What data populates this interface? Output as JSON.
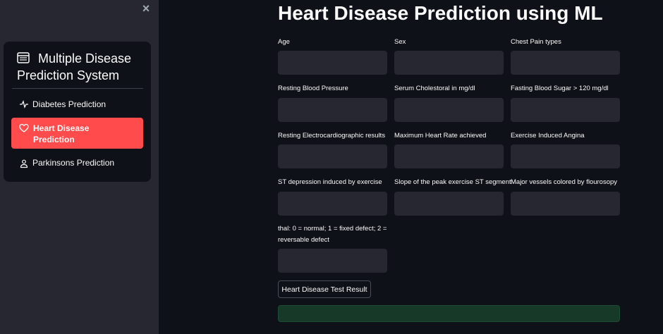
{
  "sidebar": {
    "close_label": "×",
    "menu_title": "Multiple Disease Prediction System",
    "header_icon": "list-window-icon",
    "items": [
      {
        "label": "Diabetes Prediction",
        "icon": "activity-icon",
        "active": false
      },
      {
        "label": "Heart Disease Prediction",
        "icon": "heart-icon",
        "active": true
      },
      {
        "label": "Parkinsons Prediction",
        "icon": "person-icon",
        "active": false
      }
    ],
    "active_color": "#ff4b4b"
  },
  "main": {
    "title": "Heart Disease Prediction using ML",
    "fields": [
      {
        "label": "Age",
        "value": ""
      },
      {
        "label": "Sex",
        "value": ""
      },
      {
        "label": "Chest Pain types",
        "value": ""
      },
      {
        "label": "Resting Blood Pressure",
        "value": ""
      },
      {
        "label": "Serum Cholestoral in mg/dl",
        "value": ""
      },
      {
        "label": "Fasting Blood Sugar > 120 mg/dl",
        "value": ""
      },
      {
        "label": "Resting Electrocardiographic results",
        "value": ""
      },
      {
        "label": "Maximum Heart Rate achieved",
        "value": ""
      },
      {
        "label": "Exercise Induced Angina",
        "value": ""
      },
      {
        "label": "ST depression induced by exercise",
        "value": ""
      },
      {
        "label": "Slope of the peak exercise ST segment",
        "value": ""
      },
      {
        "label": "Major vessels colored by flourosopy",
        "value": ""
      },
      {
        "label": "thal: 0 = normal; 1 = fixed defect; 2 = reversable defect",
        "value": ""
      }
    ],
    "submit_label": "Heart Disease Test Result",
    "result_text": ""
  }
}
